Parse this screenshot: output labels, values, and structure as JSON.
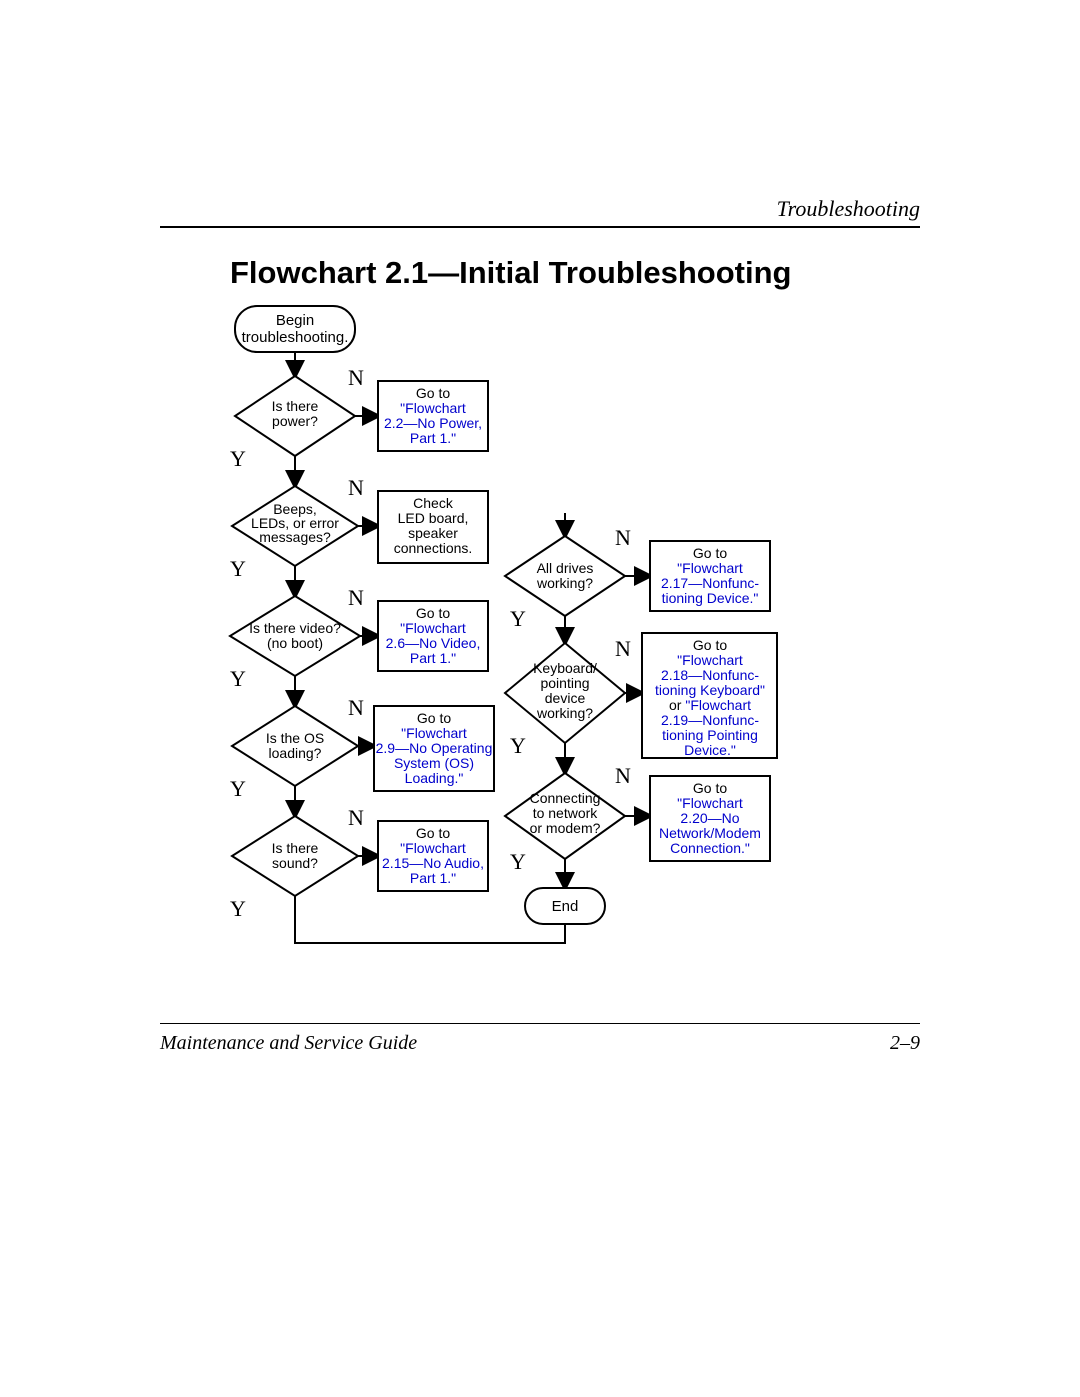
{
  "header": {
    "section": "Troubleshooting"
  },
  "title": "Flowchart 2.1—Initial Troubleshooting",
  "footer": {
    "left": "Maintenance and Service Guide",
    "right": "2–9"
  },
  "start": {
    "line1": "Begin",
    "line2": "troubleshooting."
  },
  "end": {
    "label": "End"
  },
  "yn": {
    "y": "Y",
    "n": "N"
  },
  "dec": {
    "d1": {
      "l1": "Is there",
      "l2": "power?"
    },
    "d2": {
      "l1": "Beeps,",
      "l2": "LEDs, or error",
      "l3": "messages?"
    },
    "d3": {
      "l1": "Is there video?",
      "l2": "(no boot)"
    },
    "d4": {
      "l1": "Is the OS",
      "l2": "loading?"
    },
    "d5": {
      "l1": "Is there",
      "l2": "sound?"
    },
    "d6": {
      "l1": "All drives",
      "l2": "working?"
    },
    "d7": {
      "l1": "Keyboard/",
      "l2": "pointing",
      "l3": "device",
      "l4": "working?"
    },
    "d8": {
      "l1": "Connecting",
      "l2": "to network",
      "l3": "or modem?"
    }
  },
  "proc": {
    "p1": {
      "goto": "Go to",
      "link1": "\"Flowchart",
      "link2": "2.2—No Power,",
      "link3": "Part 1.\""
    },
    "p2": {
      "l1": "Check",
      "l2": "LED board,",
      "l3": "speaker",
      "l4": "connections."
    },
    "p3": {
      "goto": "Go to",
      "link1": "\"Flowchart",
      "link2": "2.6—No Video,",
      "link3": "Part 1.\""
    },
    "p4": {
      "goto": "Go to",
      "link1": "\"Flowchart",
      "link2": "2.9—No Operating",
      "link3": "System (OS)",
      "link4": "Loading.\""
    },
    "p5": {
      "goto": "Go to",
      "link1": "\"Flowchart",
      "link2": "2.15—No Audio,",
      "link3": "Part 1.\""
    },
    "p6": {
      "goto": "Go to",
      "link1": "\"Flowchart",
      "link2": "2.17—Nonfunc-",
      "link3": "tioning Device.\""
    },
    "p7": {
      "goto": "Go to",
      "link1": "\"Flowchart",
      "link2": "2.18—Nonfunc-",
      "link3": "tioning Keyboard\"",
      "or": "or ",
      "link4": "\"Flowchart",
      "link5": "2.19—Nonfunc-",
      "link6": "tioning Pointing",
      "link7": "Device.\""
    },
    "p8": {
      "goto": "Go to",
      "link1": "\"Flowchart",
      "link2": "2.20—No",
      "link3": "Network/Modem",
      "link4": "Connection.\""
    }
  }
}
